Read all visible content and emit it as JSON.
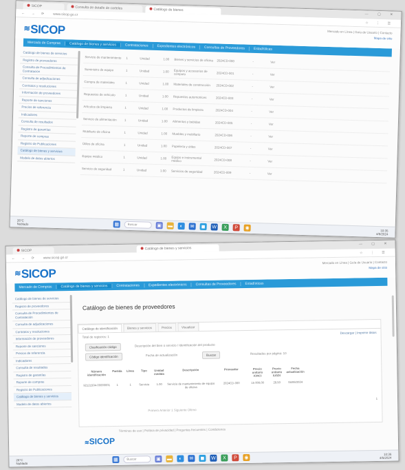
{
  "top": {
    "browser": {
      "tabs": [
        "SICOP",
        "Consulta de detalle de carteles",
        "Catálogo de bienes"
      ],
      "url": "www.sicop.go.cr"
    },
    "header": {
      "logo": "SICOP",
      "top_links": [
        "Mercado en Línea  |  Guía de Usuario  |  Contacto",
        "Mapa de sitio"
      ]
    },
    "nav": [
      "Mercado de Compras",
      "Catálogo de bienes y servicios",
      "Contrataciones",
      "Expedientes electrónicos",
      "Consultas de Proveedores",
      "Estadísticas"
    ],
    "sidebar": [
      "Catálogo de bienes de servicios",
      "Registro de proveedores",
      "Consulta de Procedimientos de Contratación",
      "Consulta de adjudicaciones",
      "Contratos y resoluciones",
      "Información de proveedores",
      "Reporte de sanciones",
      "Precios de referencia",
      "Indicadores",
      "Consulta de resultados",
      "Registro de garantías",
      "Reporte de compras",
      "Registro de Publicaciones",
      "Catálogo de bienes y servicios",
      "Modelo de datos abiertos"
    ],
    "rows_count_label": "",
    "rows": [
      [
        "Servicio de mantenimiento",
        "1",
        "Unidad",
        "1.00",
        "Bienes y servicios de oficina",
        "2024CD-000",
        "-",
        "Ver"
      ],
      [
        "Suministro de equipo",
        "1",
        "Unidad",
        "1.00",
        "Equipos y accesorios de cómputo",
        "2024CD-001",
        "-",
        "Ver"
      ],
      [
        "Compra de materiales",
        "1",
        "Unidad",
        "1.00",
        "Materiales de construcción",
        "2024CD-002",
        "-",
        "Ver"
      ],
      [
        "Repuestos de vehículo",
        "1",
        "Unidad",
        "1.00",
        "Repuestos automotrices",
        "2024CD-003",
        "-",
        "Ver"
      ],
      [
        "Artículos de limpieza",
        "1",
        "Unidad",
        "1.00",
        "Productos de limpieza",
        "2024CD-004",
        "-",
        "Ver"
      ],
      [
        "Servicio de alimentación",
        "1",
        "Unidad",
        "1.00",
        "Alimentos y bebidas",
        "2024CD-005",
        "-",
        "Ver"
      ],
      [
        "Mobiliario de oficina",
        "1",
        "Unidad",
        "1.00",
        "Muebles y mobiliario",
        "2024CD-006",
        "-",
        "Ver"
      ],
      [
        "Útiles de oficina",
        "1",
        "Unidad",
        "1.00",
        "Papelería y útiles",
        "2024CD-007",
        "-",
        "Ver"
      ],
      [
        "Equipo médico",
        "1",
        "Unidad",
        "1.00",
        "Equipo e instrumental médico",
        "2024CD-008",
        "-",
        "Ver"
      ],
      [
        "Servicio de seguridad",
        "1",
        "Unidad",
        "1.00",
        "Servicios de seguridad",
        "2024CD-009",
        "-",
        "Ver"
      ]
    ],
    "taskbar": {
      "weather": "26°C\nNublado",
      "search": "Buscar",
      "time": "10:35",
      "date": "4/6/2024"
    }
  },
  "bottom": {
    "browser": {
      "tabs": [
        "SICOP",
        "Catálogo de bienes y servicios"
      ],
      "url": "www.sicop.go.cr"
    },
    "header": {
      "logo": "SICOP",
      "top_links": [
        "Mercado en Línea  |  Guía de Usuario  |  Contacto",
        "Mapa de sitio"
      ]
    },
    "nav": [
      "Mercado de Compras",
      "Catálogo de bienes y servicios",
      "Contrataciones",
      "Expedientes electrónicos",
      "Consultas de Proveedores",
      "Estadísticas"
    ],
    "sidebar": [
      "Catálogo de bienes de servicios",
      "Registro de proveedores",
      "Consulta de Procedimientos de Contratación",
      "Consulta de adjudicaciones",
      "Contratos y resoluciones",
      "Información de proveedores",
      "Reporte de sanciones",
      "Precios de referencia",
      "Indicadores",
      "Consulta de resultados",
      "Registro de garantías",
      "Reporte de compras",
      "Registro de Publicaciones",
      "Catálogo de bienes y servicios",
      "Modelo de datos abiertos"
    ],
    "page_title": "Catálogo de bienes de proveedores",
    "tabs": [
      "Catálogo de identificación",
      "Bienes y servicios",
      "Precios",
      "Visualizar"
    ],
    "panel_note": "Total de registros: 1",
    "side_link": "Descargar | Imprimir datos",
    "btn_code": "Clasificación código",
    "btn_id": "Código identificación",
    "field_desc": "Descripción del bien o servicio / Identificación del producto",
    "field_date": "Fecha de actualización",
    "btn_search": "Buscar",
    "range_label": "Resultados por página: 10",
    "table": {
      "headers": [
        "Número identificación",
        "Partida",
        "Línea",
        "Tipo",
        "Unidad medida",
        "Descripción",
        "Proveedor",
        "Precio unitario (CRC)",
        "Precio unitario (USD)",
        "Fecha actualización"
      ],
      "row": [
        "92121504-00000001",
        "1",
        "1",
        "Servicio",
        "1.00",
        "Servicio de mantenimiento de equipo de oficina",
        "2024CD-000",
        "15 000,00",
        "28,50",
        "04/06/2024"
      ]
    },
    "pager": "1",
    "pager_right": "Primero  Anterior  1  Siguiente  Último",
    "footer_links": "Términos de uso  |  Política de privacidad  |  Preguntas frecuentes  |  Contáctenos",
    "footer_logo": "SICOP",
    "taskbar": {
      "weather": "26°C\nNublado",
      "search": "Buscar",
      "time": "10:36",
      "date": "4/6/2024"
    }
  },
  "colors": {
    "nav_blue": "#2a9ad8",
    "logo_blue": "#1a73c8",
    "link_blue": "#5a7fa8"
  }
}
